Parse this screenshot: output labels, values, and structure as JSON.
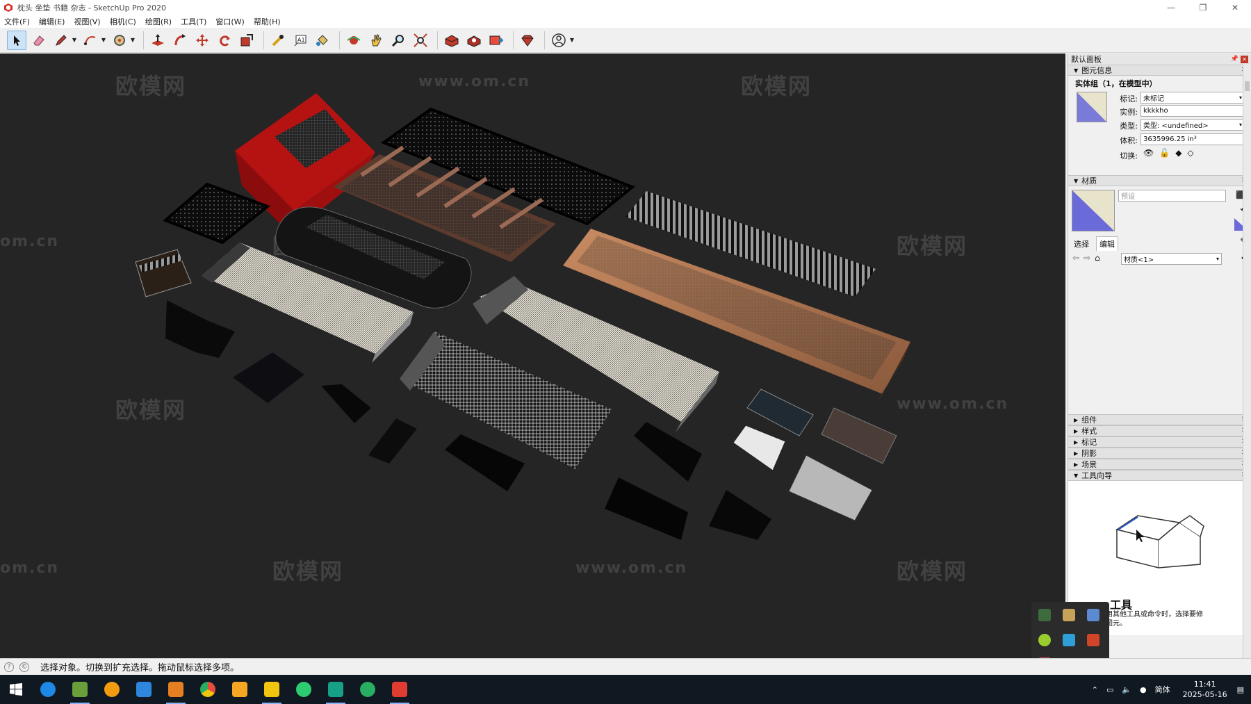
{
  "window": {
    "title": "枕头 坐垫 书籍 杂志 - SketchUp Pro 2020",
    "controls": [
      "—",
      "❐",
      "✕"
    ]
  },
  "menu": [
    "文件(F)",
    "编辑(E)",
    "视图(V)",
    "相机(C)",
    "绘图(R)",
    "工具(T)",
    "窗口(W)",
    "帮助(H)"
  ],
  "toolbar": {
    "tools": [
      {
        "name": "select-tool-button",
        "icon": "arrow-cursor-icon",
        "active": true
      },
      {
        "name": "eraser-tool-button",
        "icon": "eraser-icon"
      },
      {
        "name": "line-tool-button",
        "icon": "pencil-icon",
        "dropdown": true
      },
      {
        "name": "arc-tool-button",
        "icon": "arc-icon",
        "dropdown": true
      },
      {
        "name": "shape-tool-button",
        "icon": "circle-icon",
        "dropdown": true
      },
      {
        "name": "pushpull-tool-button",
        "icon": "push-pull-icon"
      },
      {
        "name": "followme-tool-button",
        "icon": "follow-me-icon"
      },
      {
        "name": "move-tool-button",
        "icon": "move-arrows-icon"
      },
      {
        "name": "rotate-tool-button",
        "icon": "rotate-icon"
      },
      {
        "name": "scale-tool-button",
        "icon": "scale-icon"
      },
      {
        "name": "tape-measure-button",
        "icon": "tape-measure-icon"
      },
      {
        "name": "text-tool-button",
        "icon": "text-icon"
      },
      {
        "name": "paint-bucket-button",
        "icon": "paint-bucket-icon"
      },
      {
        "name": "orbit-tool-button",
        "icon": "orbit-icon"
      },
      {
        "name": "pan-tool-button",
        "icon": "hand-icon"
      },
      {
        "name": "zoom-tool-button",
        "icon": "magnifier-icon"
      },
      {
        "name": "zoom-extents-button",
        "icon": "zoom-extents-icon"
      },
      {
        "name": "warehouse-button",
        "icon": "3d-warehouse-icon"
      },
      {
        "name": "extension-warehouse-button",
        "icon": "extension-warehouse-icon"
      },
      {
        "name": "send-to-layout-button",
        "icon": "layout-icon"
      },
      {
        "name": "extension-manager-button",
        "icon": "ruby-gem-icon"
      },
      {
        "name": "account-button",
        "icon": "user-icon",
        "dropdown": true
      }
    ]
  },
  "watermarks": [
    "欧模网",
    "www.om.cn",
    "om.cn"
  ],
  "panel": {
    "title": "默认面板",
    "entity_info": {
      "header": "图元信息",
      "entity": "实体组（1，在模型中）",
      "tag_label": "标记:",
      "tag_value": "未标记",
      "instance_label": "实例:",
      "instance_value": "kkkkho",
      "type_label": "类型:",
      "type_value": "类型: <undefined>",
      "volume_label": "体积:",
      "volume_value": "3635996.25 in³",
      "toggle_label": "切换:"
    },
    "materials": {
      "header": "材质",
      "preset_placeholder": "预设",
      "tab_select": "选择",
      "tab_edit": "编辑",
      "library": "材质<1>"
    },
    "collapsed_trays": [
      "组件",
      "样式",
      "标记",
      "阴影",
      "场景"
    ],
    "instructor": {
      "header": "工具向导",
      "title": "工具",
      "text1": "用其他工具或命令时，选择要修",
      "text2": "图元。"
    }
  },
  "status": {
    "message": "选择对象。切换到扩充选择。拖动鼠标选择多项。"
  },
  "taskbar": {
    "apps": [
      {
        "name": "start-button",
        "icon": "windows-icon",
        "color": "#ffffff"
      },
      {
        "name": "taskbar-ie",
        "icon": "ie-icon",
        "color": "#1e88e5"
      },
      {
        "name": "taskbar-minecraft",
        "icon": "grass-block-icon",
        "color": "#6a9e3b",
        "running": true
      },
      {
        "name": "taskbar-media",
        "icon": "play-icon",
        "color": "#f39c12"
      },
      {
        "name": "taskbar-security",
        "icon": "shield-icon",
        "color": "#2e86de"
      },
      {
        "name": "taskbar-movie",
        "icon": "clapper-icon",
        "color": "#e67e22",
        "running": true
      },
      {
        "name": "taskbar-chrome",
        "icon": "chrome-icon",
        "color": "#e74c3c"
      },
      {
        "name": "taskbar-box",
        "icon": "box-icon",
        "color": "#f5a623"
      },
      {
        "name": "taskbar-folder",
        "icon": "folder-icon",
        "color": "#f1c40f",
        "running": true
      },
      {
        "name": "taskbar-wechat",
        "icon": "wechat-icon",
        "color": "#2ecc71"
      },
      {
        "name": "taskbar-3",
        "icon": "number-3-icon",
        "color": "#16a085",
        "running": true
      },
      {
        "name": "taskbar-edge",
        "icon": "edge-icon",
        "color": "#27ae60"
      },
      {
        "name": "taskbar-sketchup",
        "icon": "sketchup-icon",
        "color": "#e03c31",
        "running": true
      }
    ],
    "ime": "简体",
    "time": "11:41",
    "date": "2025-05-16"
  }
}
